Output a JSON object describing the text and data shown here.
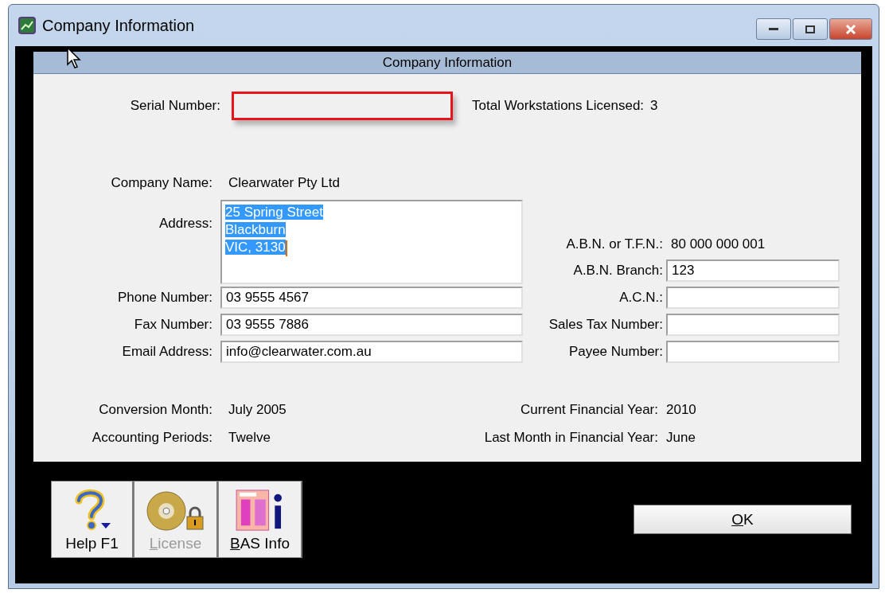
{
  "window": {
    "title": "Company Information"
  },
  "panel": {
    "title": "Company Information"
  },
  "serial": {
    "label": "Serial Number:",
    "highlighted": true
  },
  "workstations": {
    "label": "Total Workstations Licensed:",
    "value": "3"
  },
  "company_name": {
    "label": "Company Name:",
    "value": "Clearwater Pty Ltd"
  },
  "address": {
    "label": "Address:",
    "lines": [
      "25 Spring Street",
      "Blackburn",
      "VIC, 3130"
    ],
    "selected": true
  },
  "left_fields": [
    {
      "label": "Phone Number:",
      "value": "03 9555 4567"
    },
    {
      "label": "Fax Number:",
      "value": "03 9555 7886"
    },
    {
      "label": "Email Address:",
      "value": "info@clearwater.com.au"
    }
  ],
  "abn": {
    "label": "A.B.N. or T.F.N.:",
    "value": "80 000 000 001"
  },
  "right_fields": [
    {
      "label": "A.B.N. Branch:",
      "value": "123"
    },
    {
      "label": "A.C.N.:"
    },
    {
      "label": "Sales Tax Number:"
    },
    {
      "label": "Payee Number:"
    }
  ],
  "summary": [
    {
      "left": {
        "label": "Conversion Month:",
        "value": "July 2005"
      },
      "right": {
        "label": "Current Financial Year:",
        "value": "2010"
      }
    },
    {
      "left": {
        "label": "Accounting Periods:",
        "value": "Twelve"
      },
      "right": {
        "label": "Last Month in Financial Year:",
        "value": "June"
      }
    }
  ],
  "toolbar": [
    {
      "kind": "help",
      "label": "Help F1",
      "disabled": false,
      "mnemonic": false
    },
    {
      "kind": "license",
      "label": "License",
      "disabled": true,
      "mnemonic": true
    },
    {
      "kind": "bas",
      "label": "BAS Info",
      "disabled": false,
      "mnemonic": true
    }
  ],
  "ok_button": {
    "label": "OK",
    "mnemonic": true
  }
}
